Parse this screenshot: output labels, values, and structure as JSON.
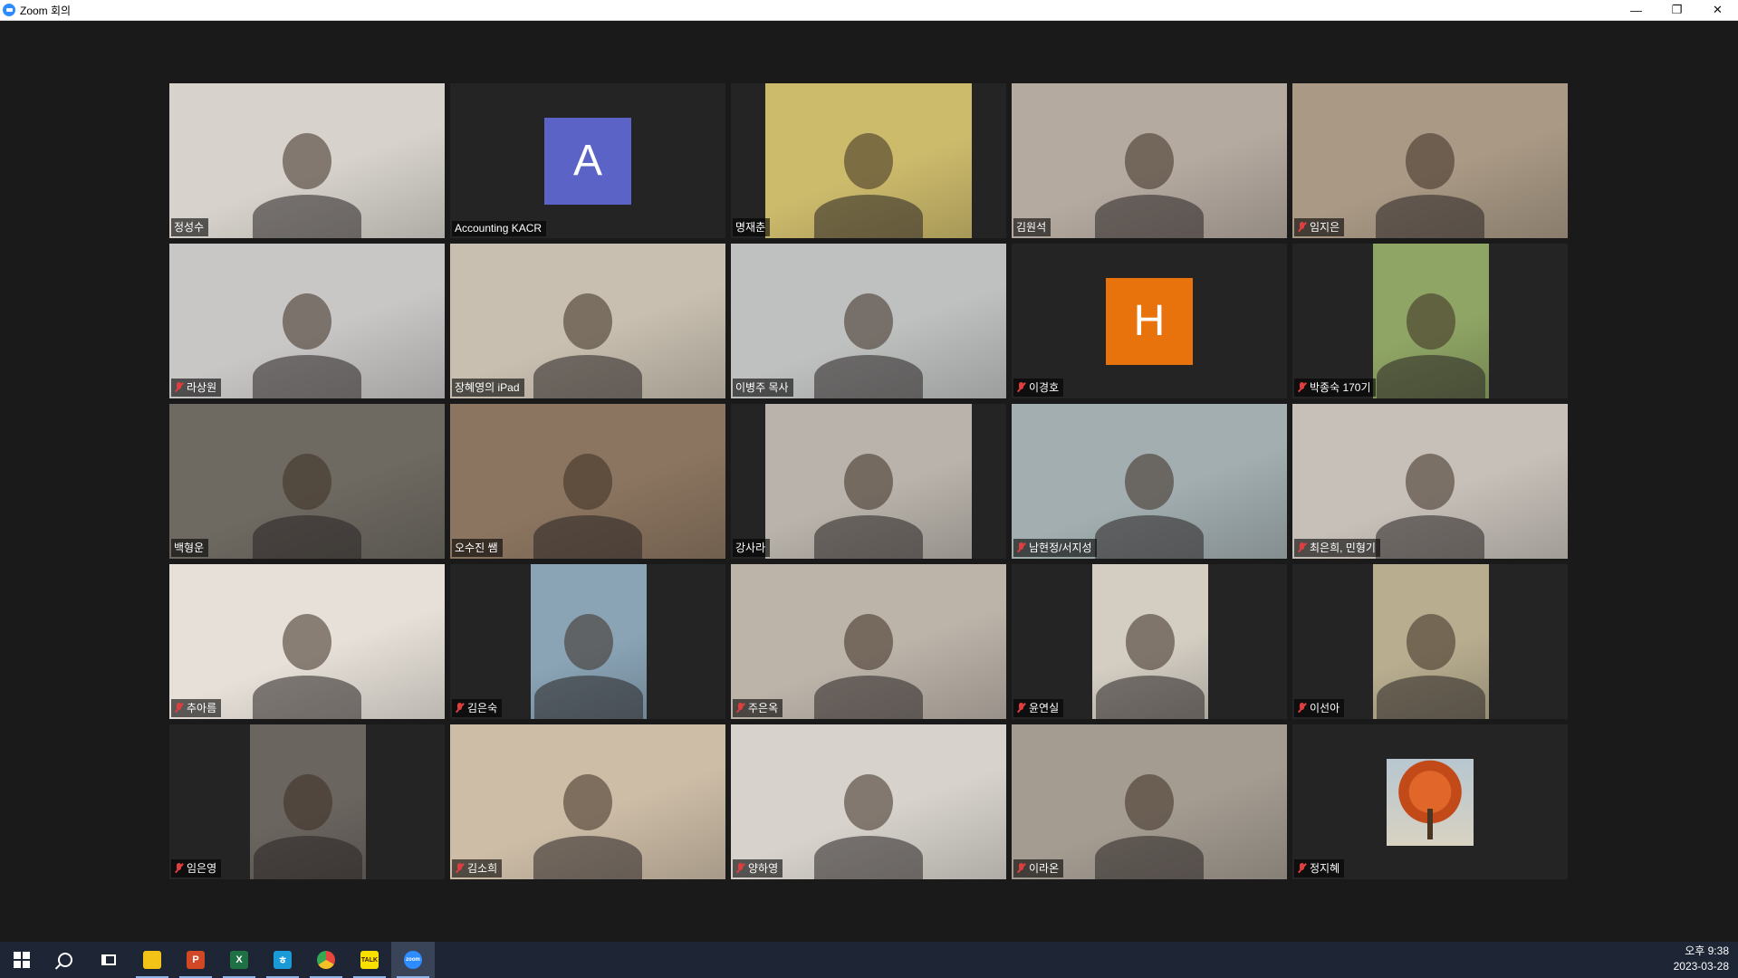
{
  "window": {
    "title": "Zoom 회의",
    "minimize": "—",
    "restore": "❐",
    "close": "✕"
  },
  "participants": [
    {
      "name": "정성수",
      "muted": false,
      "kind": "video",
      "bg": "#d7d3cc",
      "vx": 0,
      "vw": 304
    },
    {
      "name": "Accounting KACR",
      "muted": false,
      "kind": "avatar",
      "initial": "A",
      "color": "#5b63c7"
    },
    {
      "name": "명재춘",
      "muted": false,
      "kind": "video",
      "bg": "#cdbb6c",
      "vx": 38,
      "vw": 228
    },
    {
      "name": "김원석",
      "muted": false,
      "kind": "video",
      "bg": "#b5aaa0",
      "vx": 0,
      "vw": 304
    },
    {
      "name": "임지은",
      "muted": true,
      "kind": "video",
      "bg": "#a99985",
      "vx": 0,
      "vw": 304
    },
    {
      "name": "라상원",
      "muted": true,
      "kind": "video",
      "bg": "#c9c6c6",
      "vx": 0,
      "vw": 304
    },
    {
      "name": "장혜영의 iPad",
      "muted": false,
      "kind": "video",
      "bg": "#c8bfb0",
      "vx": 0,
      "vw": 304
    },
    {
      "name": "이병주 목사",
      "muted": false,
      "kind": "video",
      "bg": "#bfc1c0",
      "vx": 0,
      "vw": 304
    },
    {
      "name": "이경호",
      "muted": true,
      "kind": "avatar",
      "initial": "H",
      "color": "#e8720c"
    },
    {
      "name": "박종숙 170기",
      "muted": true,
      "kind": "video",
      "bg": "#8fa565",
      "vx": 89,
      "vw": 128
    },
    {
      "name": "백형운",
      "muted": false,
      "kind": "video",
      "bg": "#6e6a62",
      "vx": 0,
      "vw": 304
    },
    {
      "name": "오수진 쌤",
      "muted": false,
      "kind": "video",
      "bg": "#8b7560",
      "vx": 0,
      "vw": 304,
      "active": true
    },
    {
      "name": "강사라",
      "muted": false,
      "kind": "video",
      "bg": "#b9b3ab",
      "vx": 38,
      "vw": 228
    },
    {
      "name": "남현정/서지성",
      "muted": true,
      "kind": "video",
      "bg": "#a2aeb0",
      "vx": 0,
      "vw": 304
    },
    {
      "name": "최은희, 민형기",
      "muted": true,
      "kind": "video",
      "bg": "#c7c0b9",
      "vx": 0,
      "vw": 304
    },
    {
      "name": "추아름",
      "muted": true,
      "kind": "video",
      "bg": "#e6e0d8",
      "vx": 0,
      "vw": 304
    },
    {
      "name": "김은숙",
      "muted": true,
      "kind": "video",
      "bg": "#8aa4b6",
      "vx": 89,
      "vw": 128
    },
    {
      "name": "주은옥",
      "muted": true,
      "kind": "video",
      "bg": "#bcb3a9",
      "vx": 0,
      "vw": 304
    },
    {
      "name": "윤연실",
      "muted": true,
      "kind": "video",
      "bg": "#d3cdc2",
      "vx": 89,
      "vw": 128
    },
    {
      "name": "이선아",
      "muted": true,
      "kind": "video",
      "bg": "#b8ad8f",
      "vx": 89,
      "vw": 128
    },
    {
      "name": "임은영",
      "muted": true,
      "kind": "video",
      "bg": "#6b6560",
      "vx": 89,
      "vw": 128
    },
    {
      "name": "김소희",
      "muted": true,
      "kind": "video",
      "bg": "#cdbda7",
      "vx": 0,
      "vw": 304
    },
    {
      "name": "양하영",
      "muted": true,
      "kind": "video",
      "bg": "#d7d3cc",
      "vx": 0,
      "vw": 304
    },
    {
      "name": "이라온",
      "muted": true,
      "kind": "video",
      "bg": "#a49c91",
      "vx": 0,
      "vw": 304
    },
    {
      "name": "정지혜",
      "muted": true,
      "kind": "picture",
      "icon": "maple-tree-photo"
    }
  ],
  "taskbar": {
    "items": [
      {
        "name": "start-button",
        "icon": "windows-icon"
      },
      {
        "name": "search-button",
        "icon": "search-icon"
      },
      {
        "name": "task-view-button",
        "icon": "task-view-icon"
      },
      {
        "name": "file-explorer",
        "icon": "folder-icon",
        "color": "#f3c318",
        "glyph": "",
        "running": true
      },
      {
        "name": "powerpoint",
        "icon": "powerpoint-icon",
        "color": "#d24726",
        "glyph": "P",
        "running": true
      },
      {
        "name": "excel",
        "icon": "excel-icon",
        "color": "#1e7145",
        "glyph": "X",
        "running": true
      },
      {
        "name": "hangul",
        "icon": "hangul-icon",
        "color": "#1a9bd7",
        "glyph": "ㅎ",
        "running": true
      },
      {
        "name": "chrome",
        "icon": "chrome-icon",
        "color": "#e8453c",
        "glyph": "",
        "running": true
      },
      {
        "name": "kakaotalk",
        "icon": "kakaotalk-icon",
        "color": "#f9e000",
        "glyph": "TALK",
        "running": true
      },
      {
        "name": "zoom",
        "icon": "zoom-icon",
        "color": "#2d8cff",
        "glyph": "zoom",
        "running": true,
        "current": true
      }
    ]
  },
  "clock": {
    "time": "오후 9:38",
    "date": "2023-03-28"
  }
}
